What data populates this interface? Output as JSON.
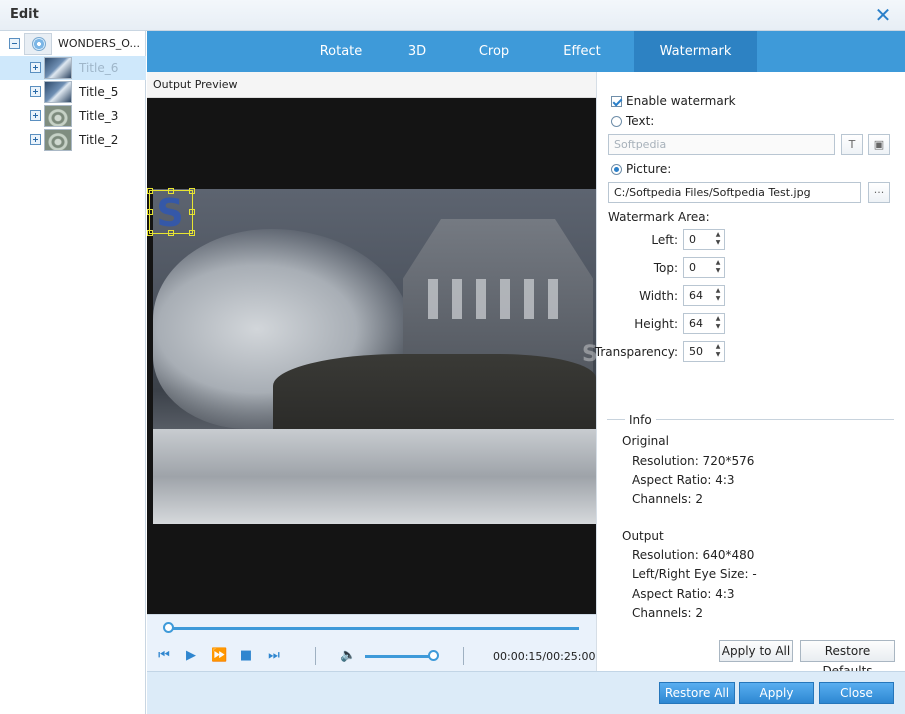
{
  "window": {
    "title": "Edit"
  },
  "tree": {
    "root_label": "WONDERS_O...",
    "items": [
      {
        "label": "Title_6",
        "thumb": "wave",
        "selected": true
      },
      {
        "label": "Title_5",
        "thumb": "wave",
        "selected": false
      },
      {
        "label": "Title_3",
        "thumb": "drop",
        "selected": false
      },
      {
        "label": "Title_2",
        "thumb": "drop",
        "selected": false
      }
    ]
  },
  "tabs": [
    "Rotate",
    "3D",
    "Crop",
    "Effect",
    "Watermark"
  ],
  "active_tab": "Watermark",
  "preview": {
    "heading": "Output Preview",
    "watermark_text": "SOFTPEDIA",
    "time": "00:00:15/00:25:00"
  },
  "watermark": {
    "enable_label": "Enable watermark",
    "enabled": true,
    "text_label": "Text:",
    "text_value": "Softpedia",
    "picture_label": "Picture:",
    "picture_path": "C:/Softpedia Files/Softpedia Test.jpg",
    "browse_label": "···",
    "area_label": "Watermark Area:",
    "left_label": "Left:",
    "left": "0",
    "top_label": "Top:",
    "top": "0",
    "width_label": "Width:",
    "width": "64",
    "height_label": "Height:",
    "height": "64",
    "transparency_label": "Transparency:",
    "transparency": "50"
  },
  "info": {
    "title": "Info",
    "original_label": "Original",
    "original": [
      "Resolution: 720*576",
      "Aspect Ratio: 4:3",
      "Channels: 2"
    ],
    "output_label": "Output",
    "output": [
      "Resolution: 640*480",
      "Left/Right Eye Size: -",
      "Aspect Ratio: 4:3",
      "Channels: 2"
    ]
  },
  "buttons": {
    "apply_to_all": "Apply to All",
    "restore_defaults": "Restore Defaults",
    "restore_all": "Restore All",
    "apply": "Apply",
    "close": "Close"
  },
  "colors": {
    "accent": "#3e9ad9",
    "tab_active": "#2d82c3"
  }
}
